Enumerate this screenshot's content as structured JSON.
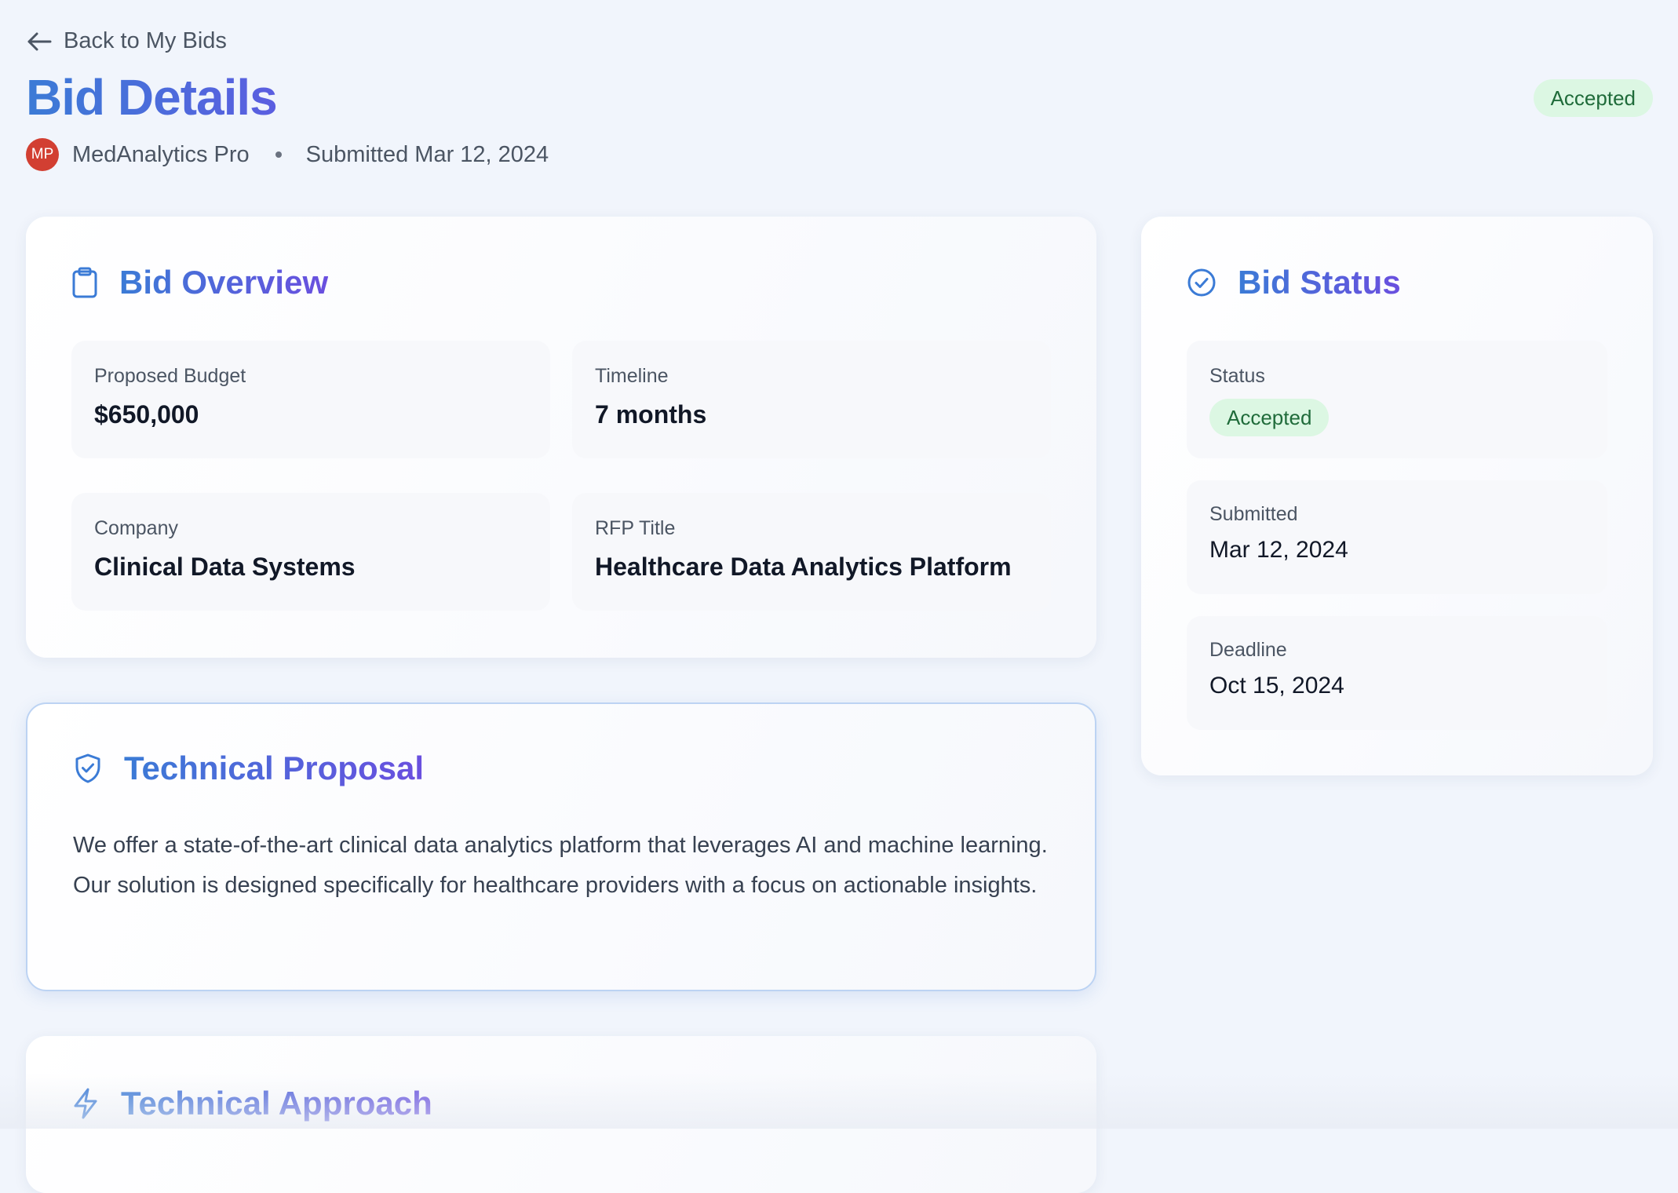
{
  "header": {
    "back_label": "Back to My Bids",
    "title": "Bid Details",
    "status": "Accepted",
    "avatar_initials": "MP",
    "company": "MedAnalytics Pro",
    "submitted": "Submitted Mar 12, 2024"
  },
  "overview": {
    "title": "Bid Overview",
    "fields": [
      {
        "label": "Proposed Budget",
        "value": "$650,000"
      },
      {
        "label": "Timeline",
        "value": "7 months"
      },
      {
        "label": "Company",
        "value": "Clinical Data Systems"
      },
      {
        "label": "RFP Title",
        "value": "Healthcare Data Analytics Platform"
      }
    ]
  },
  "bid_status": {
    "title": "Bid Status",
    "status_label": "Status",
    "status_value": "Accepted",
    "submitted_label": "Submitted",
    "submitted_value": "Mar 12, 2024",
    "deadline_label": "Deadline",
    "deadline_value": "Oct 15, 2024"
  },
  "technical_proposal": {
    "title": "Technical Proposal",
    "body": "We offer a state-of-the-art clinical data analytics platform that leverages AI and machine learning. Our solution is designed specifically for healthcare providers with a focus on actionable insights."
  },
  "technical_approach": {
    "title": "Technical Approach"
  },
  "colors": {
    "accent_blue": "#3b7bd6",
    "accent_purple": "#6a4fdf",
    "status_bg": "#dcf7e3",
    "status_text": "#1f6b3a",
    "avatar_bg": "#d23f32",
    "page_bg": "#f1f5fc"
  },
  "icons": {
    "back": "arrow-left-icon",
    "overview": "clipboard-icon",
    "status": "check-circle-icon",
    "proposal": "shield-check-icon",
    "approach": "lightning-bolt-icon"
  }
}
